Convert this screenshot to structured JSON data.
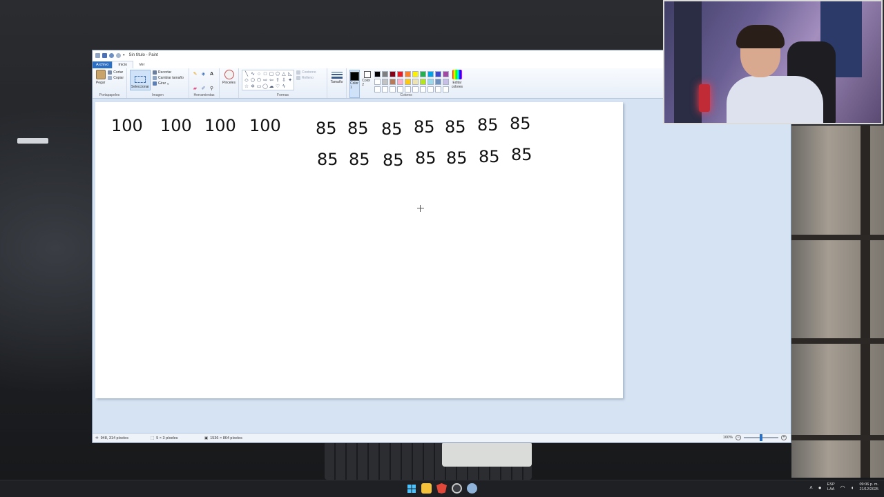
{
  "window": {
    "title": "Sin título - Paint"
  },
  "menu": {
    "tabs": [
      "Archivo",
      "Inicio",
      "Ver"
    ]
  },
  "ribbon": {
    "clipboard": {
      "paste": "Pegar",
      "cut": "Cortar",
      "copy": "Copiar",
      "label": "Portapapeles"
    },
    "image": {
      "select": "Seleccionar",
      "crop": "Recortar",
      "resize": "Cambiar tamaño",
      "rotate": "Girar",
      "label": "Imagen"
    },
    "tools": {
      "label": "Herramientas"
    },
    "brushes": {
      "label": "Pinceles"
    },
    "shapes": {
      "outline": "Contorno",
      "fill": "Relleno",
      "label": "Formas"
    },
    "size": {
      "label": "Tamaño"
    },
    "colors": {
      "color1": "Color 1",
      "color2": "Color 2",
      "edit": "Editar colores",
      "label": "Colores",
      "color1_value": "#000000",
      "color2_value": "#ffffff",
      "palette": [
        "#000000",
        "#7f7f7f",
        "#880015",
        "#ed1c24",
        "#ff7f27",
        "#fff200",
        "#22b14c",
        "#00a2e8",
        "#3f48cc",
        "#a349a4",
        "#ffffff",
        "#c3c3c3",
        "#b97a57",
        "#ffaec9",
        "#ffc90e",
        "#efe4b0",
        "#b5e61d",
        "#99d9ea",
        "#7092be",
        "#c8bfe7",
        "#ffffff",
        "#ffffff",
        "#ffffff",
        "#ffffff",
        "#ffffff",
        "#ffffff",
        "#ffffff",
        "#ffffff",
        "#ffffff",
        "#ffffff"
      ]
    }
  },
  "canvas": {
    "row1_left": [
      "100",
      "100",
      "100",
      "100"
    ],
    "row1_right": [
      "85",
      "85",
      "85",
      "85",
      "85",
      "85",
      "85"
    ],
    "row2_right": [
      "85",
      "85",
      "85",
      "85",
      "85",
      "85",
      "85"
    ]
  },
  "status": {
    "cursor": "948, 314 píxeles",
    "selection": "5 × 3 píxeles",
    "size": "1536 × 864 píxeles",
    "zoom": "100%",
    "zoom_level": 1.0
  },
  "taskbar": {
    "lang_top": "ESP",
    "lang_bottom": "LAA",
    "time": "09:06 p. m.",
    "date": "21/12/2025"
  }
}
